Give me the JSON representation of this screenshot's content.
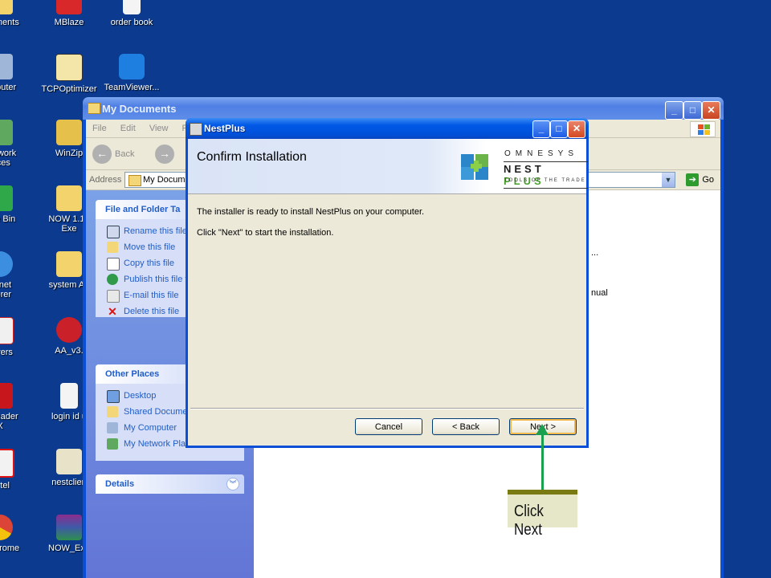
{
  "desktop": {
    "icons": [
      {
        "label": "ocuments"
      },
      {
        "label": "MBlaze"
      },
      {
        "label": "order book"
      },
      {
        "label": "omputer"
      },
      {
        "label": "TCPOptimizer"
      },
      {
        "label": "TeamViewer..."
      },
      {
        "label": "Network\nlaces"
      },
      {
        "label": "WinZip"
      },
      {
        "label": "ycle Bin"
      },
      {
        "label": "NOW 1.13\nExe"
      },
      {
        "label": "ternet\nplorer"
      },
      {
        "label": "system Au"
      },
      {
        "label": "iievers"
      },
      {
        "label": "AA_v3."
      },
      {
        "label": "e Reader\nX"
      },
      {
        "label": "login id u"
      },
      {
        "label": "airtel"
      },
      {
        "label": "nestclien"
      },
      {
        "label": "e Chrome"
      },
      {
        "label": "NOW_Exe"
      }
    ]
  },
  "explorer": {
    "title": "My Documents",
    "menu": [
      "File",
      "Edit",
      "View",
      "Fa"
    ],
    "back_label": "Back",
    "address_label": "Address",
    "address_value": "My Docume",
    "go_label": "Go",
    "file_tasks": {
      "title": "File and Folder Ta",
      "items": [
        "Rename this file",
        "Move this file",
        "Copy this file",
        "Publish this file t",
        "E-mail this file",
        "Delete this file"
      ]
    },
    "other_places": {
      "title": "Other Places",
      "items": [
        "Desktop",
        "Shared Docume",
        "My Computer",
        "My Network Plac"
      ]
    },
    "details": {
      "title": "Details"
    },
    "file_fragments": [
      "...",
      "nual"
    ]
  },
  "dialog": {
    "title": "NestPlus",
    "heading": "Confirm Installation",
    "logo": {
      "top": "OMNESYS",
      "nest": "NEST",
      "plus": "PLUS",
      "tagline": "TOOLS OF THE TRADE"
    },
    "message1": "The installer is ready to install NestPlus on your computer.",
    "message2": "Click \"Next\" to start the installation.",
    "buttons": {
      "cancel": "Cancel",
      "back": "< Back",
      "next": "Next >"
    }
  },
  "annotation": {
    "text": "Click Next"
  }
}
